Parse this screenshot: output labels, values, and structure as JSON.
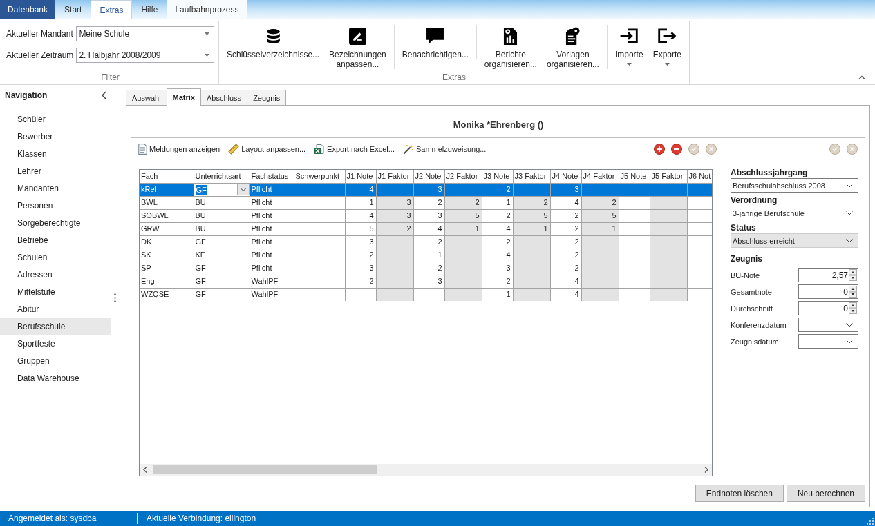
{
  "ribbon_tabs": [
    {
      "label": "Datenbank",
      "kind": "file",
      "selected": false
    },
    {
      "label": "Start",
      "kind": "standard",
      "selected": false
    },
    {
      "label": "Extras",
      "kind": "standard",
      "selected": true
    },
    {
      "label": "Hilfe",
      "kind": "standard",
      "selected": false
    },
    {
      "label": "Laufbahnprozess",
      "kind": "contextual",
      "selected": false
    }
  ],
  "filter_group": {
    "label": "Filter",
    "fields": [
      {
        "label": "Aktueller Mandant",
        "value": "Meine Schule"
      },
      {
        "label": "Aktueller Zeitraum",
        "value": "2. Halbjahr 2008/2009"
      }
    ]
  },
  "extras_group": {
    "label": "Extras",
    "sections": [
      {
        "buttons": [
          {
            "label": "Schlüsselverzeichnisse...",
            "dropdown": false
          },
          {
            "label": "Bezeichnungen anpassen...",
            "dropdown": false
          }
        ]
      },
      {
        "buttons": [
          {
            "label": "Benachrichtigen...",
            "dropdown": false
          }
        ]
      },
      {
        "buttons": [
          {
            "label": "Berichte organisieren...",
            "dropdown": false
          },
          {
            "label": "Vorlagen organisieren...",
            "dropdown": false
          }
        ]
      },
      {
        "buttons": [
          {
            "label": "Importe",
            "dropdown": true
          },
          {
            "label": "Exporte",
            "dropdown": true
          }
        ]
      }
    ]
  },
  "navigation": {
    "title": "Navigation",
    "items": [
      {
        "label": "Schüler",
        "selected": false
      },
      {
        "label": "Bewerber",
        "selected": false
      },
      {
        "label": "Klassen",
        "selected": false
      },
      {
        "label": "Lehrer",
        "selected": false
      },
      {
        "label": "Mandanten",
        "selected": false
      },
      {
        "label": "Personen",
        "selected": false
      },
      {
        "label": "Sorgeberechtigte",
        "selected": false
      },
      {
        "label": "Betriebe",
        "selected": false
      },
      {
        "label": "Schulen",
        "selected": false
      },
      {
        "label": "Adressen",
        "selected": false
      },
      {
        "label": "Mittelstufe",
        "selected": false
      },
      {
        "label": "Abitur",
        "selected": false
      },
      {
        "label": "Berufsschule",
        "selected": true
      },
      {
        "label": "Sportfeste",
        "selected": false
      },
      {
        "label": "Gruppen",
        "selected": false
      },
      {
        "label": "Data Warehouse",
        "selected": false
      }
    ]
  },
  "content_tabs": [
    {
      "label": "Auswahl",
      "selected": false
    },
    {
      "label": "Matrix",
      "selected": true
    },
    {
      "label": "Abschluss",
      "selected": false
    },
    {
      "label": "Zeugnis",
      "selected": false
    }
  ],
  "record_title": "Monika *Ehrenberg ()",
  "grid_toolbar": {
    "tools": [
      "Meldungen anzeigen",
      "Layout anpassen...",
      "Export nach Excel...",
      "Sammelzuweisung..."
    ],
    "row_actions": [
      {
        "kind": "add",
        "disabled": false
      },
      {
        "kind": "remove",
        "disabled": false
      },
      {
        "kind": "confirm",
        "disabled": true
      },
      {
        "kind": "cancel",
        "disabled": true
      }
    ],
    "panel_actions": [
      {
        "kind": "confirm",
        "disabled": true
      },
      {
        "kind": "cancel",
        "disabled": true
      }
    ]
  },
  "table": {
    "columns": [
      {
        "label": "Fach",
        "kind": "text"
      },
      {
        "label": "Unterrichtsart",
        "kind": "choice"
      },
      {
        "label": "Fachstatus",
        "kind": "text"
      },
      {
        "label": "Schwerpunkt",
        "kind": "text"
      },
      {
        "label": "J1 Note",
        "kind": "grade"
      },
      {
        "label": "J1 Faktor",
        "kind": "factor"
      },
      {
        "label": "J2 Note",
        "kind": "grade"
      },
      {
        "label": "J2 Faktor",
        "kind": "factor"
      },
      {
        "label": "J3 Note",
        "kind": "grade"
      },
      {
        "label": "J3 Faktor",
        "kind": "factor"
      },
      {
        "label": "J4 Note",
        "kind": "grade"
      },
      {
        "label": "J4 Faktor",
        "kind": "factor"
      },
      {
        "label": "J5 Note",
        "kind": "grade"
      },
      {
        "label": "J5 Faktor",
        "kind": "factor"
      },
      {
        "label": "J6 Not",
        "kind": "grade"
      }
    ],
    "rows": [
      {
        "selected": true,
        "cells": [
          "kRel",
          "GF",
          "Pflicht",
          null,
          "4",
          null,
          "3",
          null,
          "2",
          null,
          "3",
          null,
          null,
          null,
          null
        ]
      },
      {
        "selected": false,
        "cells": [
          "BWL",
          "BU",
          "Pflicht",
          null,
          "1",
          "3",
          "2",
          "2",
          "1",
          "2",
          "4",
          "2",
          null,
          null,
          null
        ]
      },
      {
        "selected": false,
        "cells": [
          "SOBWL",
          "BU",
          "Pflicht",
          null,
          "4",
          "3",
          "3",
          "5",
          "2",
          "5",
          "2",
          "5",
          null,
          null,
          null
        ]
      },
      {
        "selected": false,
        "cells": [
          "GRW",
          "BU",
          "Pflicht",
          null,
          "5",
          "2",
          "4",
          "1",
          "4",
          "1",
          "2",
          "1",
          null,
          null,
          null
        ]
      },
      {
        "selected": false,
        "cells": [
          "DK",
          "GF",
          "Pflicht",
          null,
          "3",
          null,
          "2",
          null,
          "2",
          null,
          "2",
          null,
          null,
          null,
          null
        ]
      },
      {
        "selected": false,
        "cells": [
          "SK",
          "KF",
          "Pflicht",
          null,
          "2",
          null,
          "1",
          null,
          "4",
          null,
          "2",
          null,
          null,
          null,
          null
        ]
      },
      {
        "selected": false,
        "cells": [
          "SP",
          "GF",
          "Pflicht",
          null,
          "3",
          null,
          "2",
          null,
          "3",
          null,
          "2",
          null,
          null,
          null,
          null
        ]
      },
      {
        "selected": false,
        "cells": [
          "Eng",
          "GF",
          "WahlPF",
          null,
          "2",
          null,
          "3",
          null,
          "2",
          null,
          "4",
          null,
          null,
          null,
          null
        ]
      },
      {
        "selected": false,
        "cells": [
          "WZQSE",
          "GF",
          "WahlPF",
          null,
          null,
          null,
          null,
          null,
          "1",
          null,
          "4",
          null,
          null,
          null,
          null
        ]
      }
    ]
  },
  "side_panel": {
    "selects": [
      {
        "label": "Abschlussjahrgang",
        "value": "Berufsschulabschluss 2008",
        "disabled": false
      },
      {
        "label": "Verordnung",
        "value": "3-jährige Berufschule",
        "disabled": false
      },
      {
        "label": "Status",
        "value": "Abschluss erreicht",
        "disabled": true
      }
    ],
    "section_title": "Zeugnis",
    "fields": [
      {
        "label": "BU-Note",
        "kind": "spin",
        "value": "2,57"
      },
      {
        "label": "Gesamtnote",
        "kind": "spin",
        "value": "0"
      },
      {
        "label": "Durchschnitt",
        "kind": "spin",
        "value": "0"
      },
      {
        "label": "Konferenzdatum",
        "kind": "date"
      },
      {
        "label": "Zeugnisdatum",
        "kind": "date"
      }
    ]
  },
  "footer_buttons": [
    "Endnoten löschen",
    "Neu berechnen"
  ],
  "status_bar": [
    "Angemeldet als: sysdba",
    "Aktuelle Verbindung: ellington"
  ]
}
